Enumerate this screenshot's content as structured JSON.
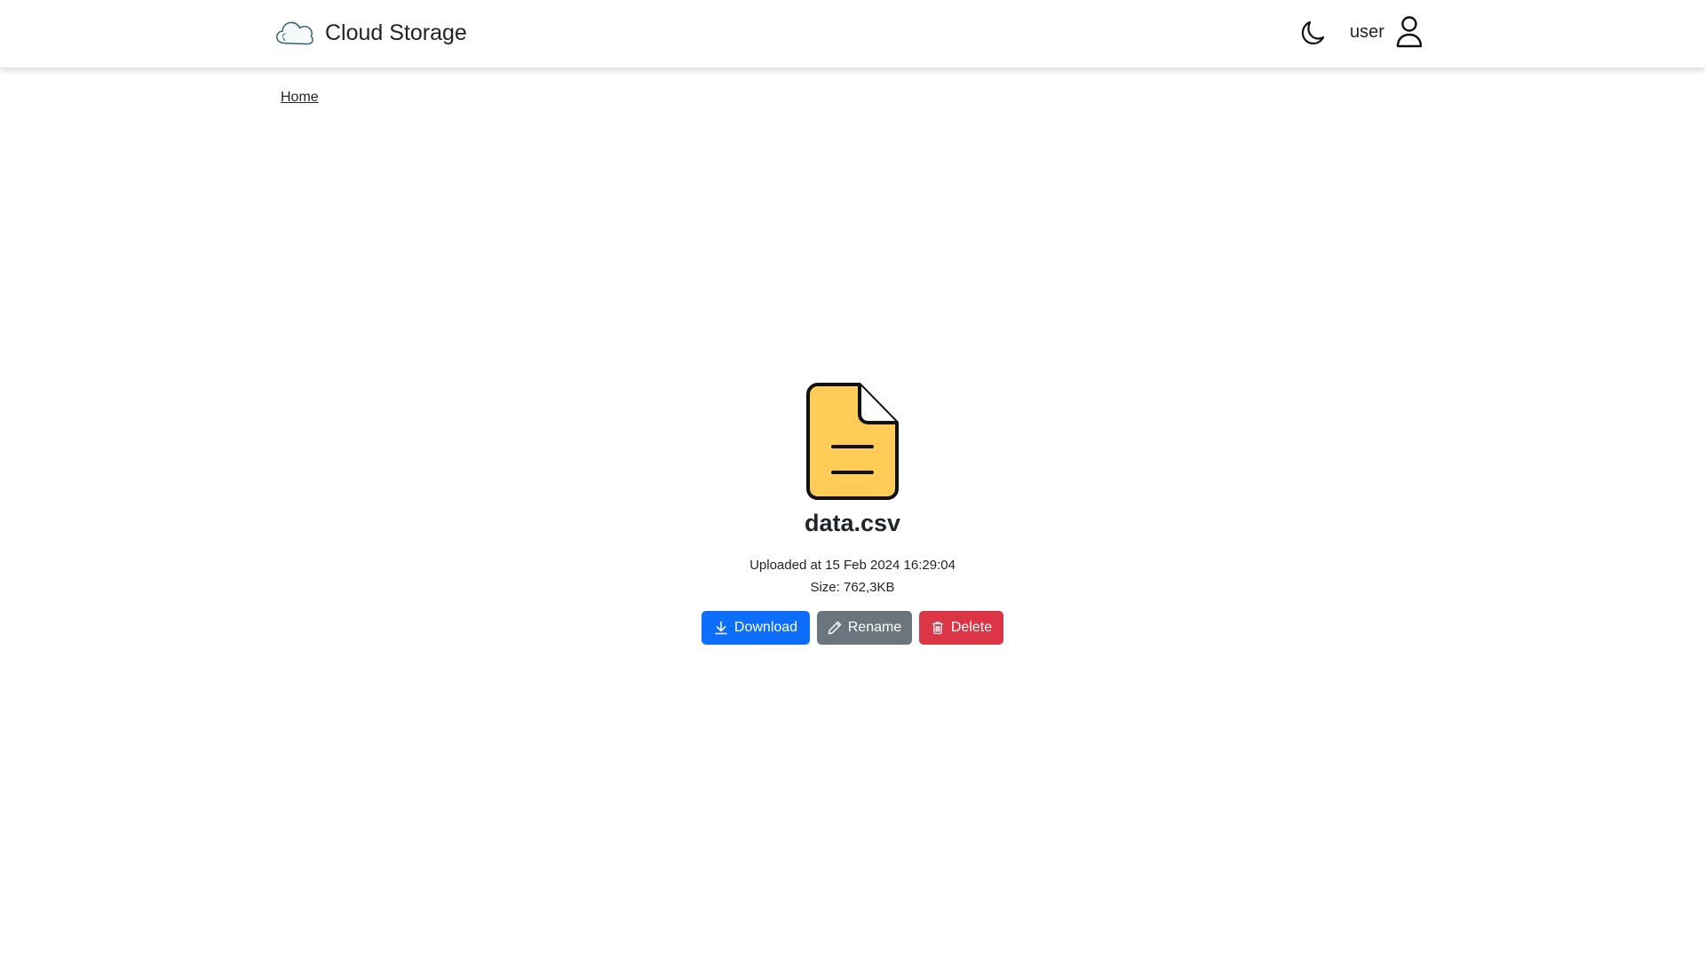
{
  "app": {
    "brand_label": "Cloud Storage",
    "brand_icon": "cloud-icon",
    "theme_icon": "moon-icon",
    "user_label": "user",
    "user_icon": "person-icon"
  },
  "breadcrumb": {
    "items": [
      "Home"
    ]
  },
  "file": {
    "name": "data.csv",
    "icon": "file-text-icon",
    "icon_color": "#ffcd57",
    "uploaded": "Uploaded at 15 Feb 2024 16:29:04",
    "size": "Size: 762,3KB"
  },
  "actions": {
    "download_label": "Download",
    "rename_label": "Rename",
    "delete_label": "Delete",
    "download_color": "#0d6efd",
    "rename_color": "#6c757d",
    "delete_color": "#dc3545"
  }
}
